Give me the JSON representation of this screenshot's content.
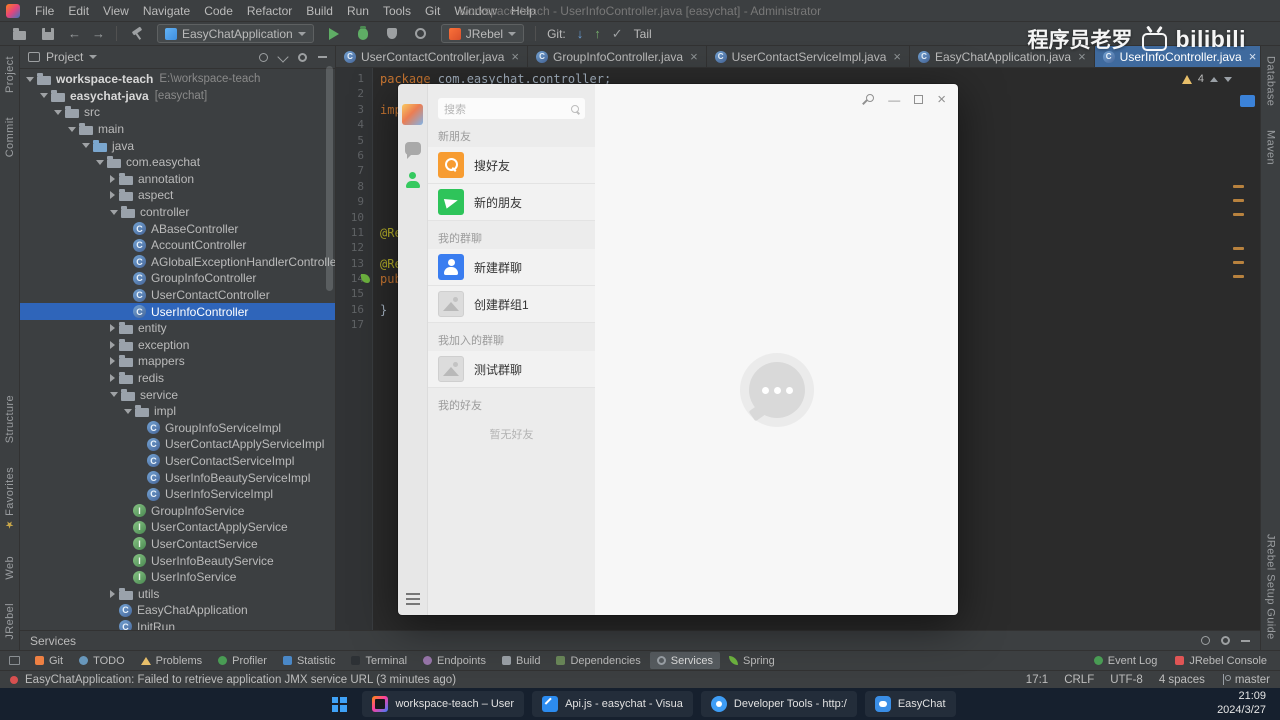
{
  "menubar": {
    "items": [
      "File",
      "Edit",
      "View",
      "Navigate",
      "Code",
      "Refactor",
      "Build",
      "Run",
      "Tools",
      "Git",
      "Window",
      "Help"
    ],
    "title": "workspace-teach - UserInfoController.java [easychat] - Administrator"
  },
  "icons": {
    "close": "×",
    "minimize": "—",
    "back": "←",
    "forward": "→",
    "git_update": "↓",
    "git_push": "↑",
    "git_check": "✓",
    "star": "★",
    "class_letter": "C",
    "interface_letter": "I"
  },
  "toolbar": {
    "run_config": "EasyChatApplication",
    "jrebel_label": "JRebel",
    "git_label": "Git:",
    "tail_label": "Tail"
  },
  "project_panel": {
    "title": "Project"
  },
  "project_tree": {
    "items": [
      {
        "level": 0,
        "label": "workspace-teach",
        "extra": "E:\\workspace-teach",
        "icon": "folder",
        "chevron": "expanded",
        "bold": true
      },
      {
        "level": 1,
        "label": "easychat-java",
        "extra": "[easychat]",
        "icon": "folder",
        "chevron": "expanded",
        "bold": true
      },
      {
        "level": 2,
        "label": "src",
        "icon": "folder",
        "chevron": "expanded"
      },
      {
        "level": 3,
        "label": "main",
        "icon": "folder",
        "chevron": "expanded"
      },
      {
        "level": 4,
        "label": "java",
        "icon": "folder-src",
        "chevron": "expanded"
      },
      {
        "level": 5,
        "label": "com.easychat",
        "icon": "folder",
        "chevron": "expanded"
      },
      {
        "level": 6,
        "label": "annotation",
        "icon": "folder",
        "chevron": "collapsed"
      },
      {
        "level": 6,
        "label": "aspect",
        "icon": "folder",
        "chevron": "collapsed"
      },
      {
        "level": 6,
        "label": "controller",
        "icon": "folder",
        "chevron": "expanded"
      },
      {
        "level": 7,
        "label": "ABaseController",
        "icon": "class"
      },
      {
        "level": 7,
        "label": "AccountController",
        "icon": "class"
      },
      {
        "level": 7,
        "label": "AGlobalExceptionHandlerController",
        "icon": "class"
      },
      {
        "level": 7,
        "label": "GroupInfoController",
        "icon": "class"
      },
      {
        "level": 7,
        "label": "UserContactController",
        "icon": "class"
      },
      {
        "level": 7,
        "label": "UserInfoController",
        "icon": "class",
        "selected": true
      },
      {
        "level": 6,
        "label": "entity",
        "icon": "folder",
        "chevron": "collapsed"
      },
      {
        "level": 6,
        "label": "exception",
        "icon": "folder",
        "chevron": "collapsed"
      },
      {
        "level": 6,
        "label": "mappers",
        "icon": "folder",
        "chevron": "collapsed"
      },
      {
        "level": 6,
        "label": "redis",
        "icon": "folder",
        "chevron": "collapsed"
      },
      {
        "level": 6,
        "label": "service",
        "icon": "folder",
        "chevron": "expanded"
      },
      {
        "level": 7,
        "label": "impl",
        "icon": "folder",
        "chevron": "expanded"
      },
      {
        "level": 8,
        "label": "GroupInfoServiceImpl",
        "icon": "class"
      },
      {
        "level": 8,
        "label": "UserContactApplyServiceImpl",
        "icon": "class"
      },
      {
        "level": 8,
        "label": "UserContactServiceImpl",
        "icon": "class"
      },
      {
        "level": 8,
        "label": "UserInfoBeautyServiceImpl",
        "icon": "class"
      },
      {
        "level": 8,
        "label": "UserInfoServiceImpl",
        "icon": "class"
      },
      {
        "level": 7,
        "label": "GroupInfoService",
        "icon": "interface"
      },
      {
        "level": 7,
        "label": "UserContactApplyService",
        "icon": "interface"
      },
      {
        "level": 7,
        "label": "UserContactService",
        "icon": "interface"
      },
      {
        "level": 7,
        "label": "UserInfoBeautyService",
        "icon": "interface"
      },
      {
        "level": 7,
        "label": "UserInfoService",
        "icon": "interface"
      },
      {
        "level": 6,
        "label": "utils",
        "icon": "folder",
        "chevron": "collapsed"
      },
      {
        "level": 6,
        "label": "EasyChatApplication",
        "icon": "class"
      },
      {
        "level": 6,
        "label": "InitRun",
        "icon": "class"
      }
    ]
  },
  "editor": {
    "tabs": [
      {
        "label": "UserContactController.java",
        "selected": false
      },
      {
        "label": "GroupInfoController.java",
        "selected": false
      },
      {
        "label": "UserContactServiceImpl.java",
        "selected": false
      },
      {
        "label": "EasyChatApplication.java",
        "selected": false
      },
      {
        "label": "UserInfoController.java",
        "selected": true
      }
    ],
    "line_count": 17,
    "code_lines": [
      {
        "line": 1,
        "parts": [
          {
            "text": "package ",
            "style": "keyword"
          },
          {
            "text": "com.easychat.controller;",
            "style": "plain"
          }
        ]
      },
      {
        "line": 3,
        "parts": [
          {
            "text": "impo",
            "style": "keyword"
          }
        ]
      },
      {
        "line": 11,
        "parts": [
          {
            "text": "@Res",
            "style": "annotation"
          }
        ]
      },
      {
        "line": 13,
        "parts": [
          {
            "text": "@Req",
            "style": "annotation"
          }
        ]
      },
      {
        "line": 14,
        "parts": [
          {
            "text": "publ",
            "style": "keyword"
          }
        ]
      },
      {
        "line": 16,
        "parts": [
          {
            "text": "}",
            "style": "plain"
          }
        ]
      }
    ],
    "inspections": {
      "warning_count": "4"
    }
  },
  "easychat": {
    "search_placeholder": "搜索",
    "sections": [
      {
        "header": "新朋友",
        "items": [
          {
            "label": "搜好友",
            "icon": "search-orange"
          },
          {
            "label": "新的朋友",
            "icon": "plane-green"
          }
        ]
      },
      {
        "header": "我的群聊",
        "items": [
          {
            "label": "新建群聊",
            "icon": "group-blue"
          },
          {
            "label": "创建群组1",
            "icon": "image-placeholder"
          }
        ]
      },
      {
        "header": "我加入的群聊",
        "items": [
          {
            "label": "测试群聊",
            "icon": "image-placeholder"
          }
        ]
      },
      {
        "header": "我的好友",
        "items": [],
        "empty_text": "暂无好友"
      }
    ]
  },
  "left_stripe": {
    "top": [
      "Project",
      "Commit"
    ],
    "bottom": [
      "Structure",
      "Favorites",
      "Web",
      "JRebel"
    ]
  },
  "right_stripe": {
    "top": [
      "Database",
      "Maven"
    ],
    "bottom": [
      "JRebel Setup Guide"
    ]
  },
  "services_panel": {
    "title": "Services"
  },
  "tool_buttons": {
    "left": [
      "Git",
      "TODO",
      "Problems",
      "Profiler",
      "Statistic",
      "Terminal",
      "Endpoints",
      "Build",
      "Dependencies",
      "Services",
      "Spring"
    ],
    "selected": "Services",
    "right": [
      "Event Log",
      "JRebel Console"
    ]
  },
  "status_bar": {
    "message": "EasyChatApplication: Failed to retrieve application JMX service URL (3 minutes ago)",
    "items": [
      "17:1",
      "CRLF",
      "UTF-8",
      "4 spaces"
    ],
    "branch": "master"
  },
  "taskbar": {
    "apps": [
      {
        "label": "workspace-teach – User",
        "icon": "intellij"
      },
      {
        "label": "Api.js - easychat - Visua",
        "icon": "vscode"
      },
      {
        "label": "Developer Tools - http:/",
        "icon": "devtools"
      },
      {
        "label": "EasyChat",
        "icon": "easychat"
      }
    ],
    "time": "21:09",
    "date": "2024/3/27"
  },
  "watermark": {
    "text": "程序员老罗",
    "brand": "bilibili"
  }
}
